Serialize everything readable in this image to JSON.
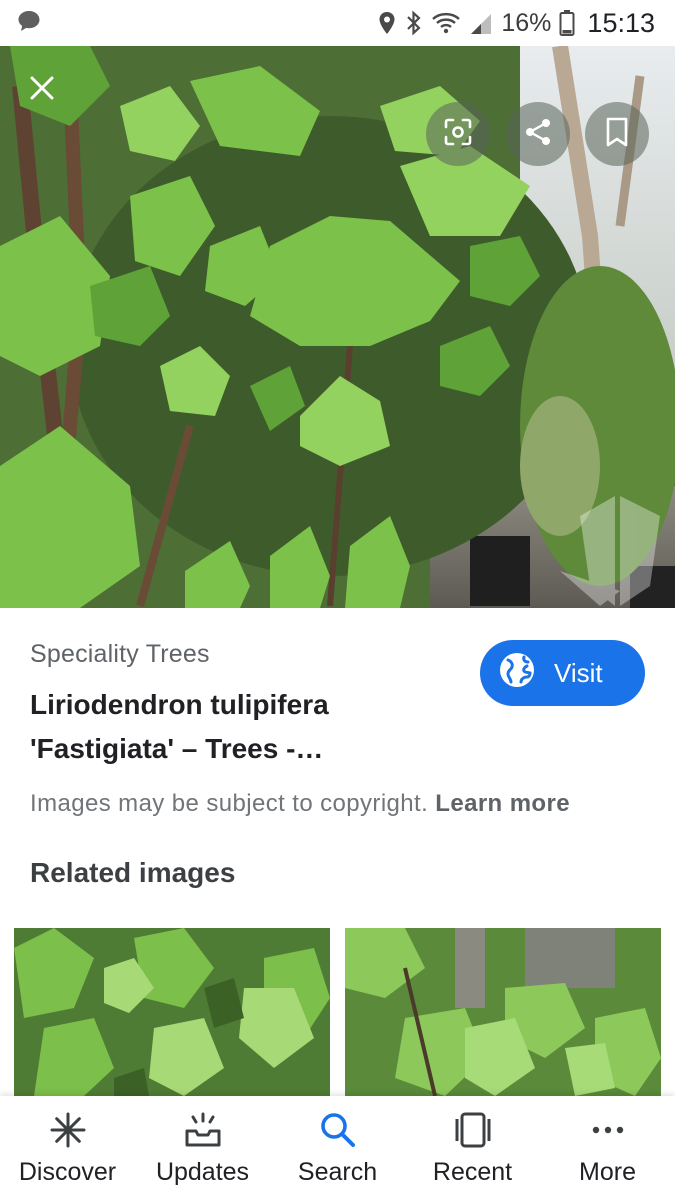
{
  "status_bar": {
    "battery": "16%",
    "time": "15:13",
    "icons": [
      "message-icon",
      "location-icon",
      "bluetooth-icon",
      "wifi-icon",
      "signal-icon",
      "battery-icon"
    ]
  },
  "hero": {
    "icons": [
      "close-icon",
      "lens-icon",
      "share-icon",
      "bookmark-icon"
    ]
  },
  "result": {
    "source": "Speciality Trees",
    "title": "Liriodendron tulipifera 'Fastigiata' – Trees -…",
    "visit_label": "Visit"
  },
  "copyright": {
    "text": "Images may be subject to copyright.",
    "link": "Learn more"
  },
  "related": {
    "heading": "Related images"
  },
  "bottom_nav": {
    "items": [
      {
        "label": "Discover",
        "icon": "asterisk-icon"
      },
      {
        "label": "Updates",
        "icon": "updates-icon"
      },
      {
        "label": "Search",
        "icon": "search-icon"
      },
      {
        "label": "Recent",
        "icon": "recent-icon"
      },
      {
        "label": "More",
        "icon": "more-icon"
      }
    ],
    "active": "Search"
  },
  "colors": {
    "accent": "#1a73e8",
    "leaf": "#6fb53f"
  }
}
